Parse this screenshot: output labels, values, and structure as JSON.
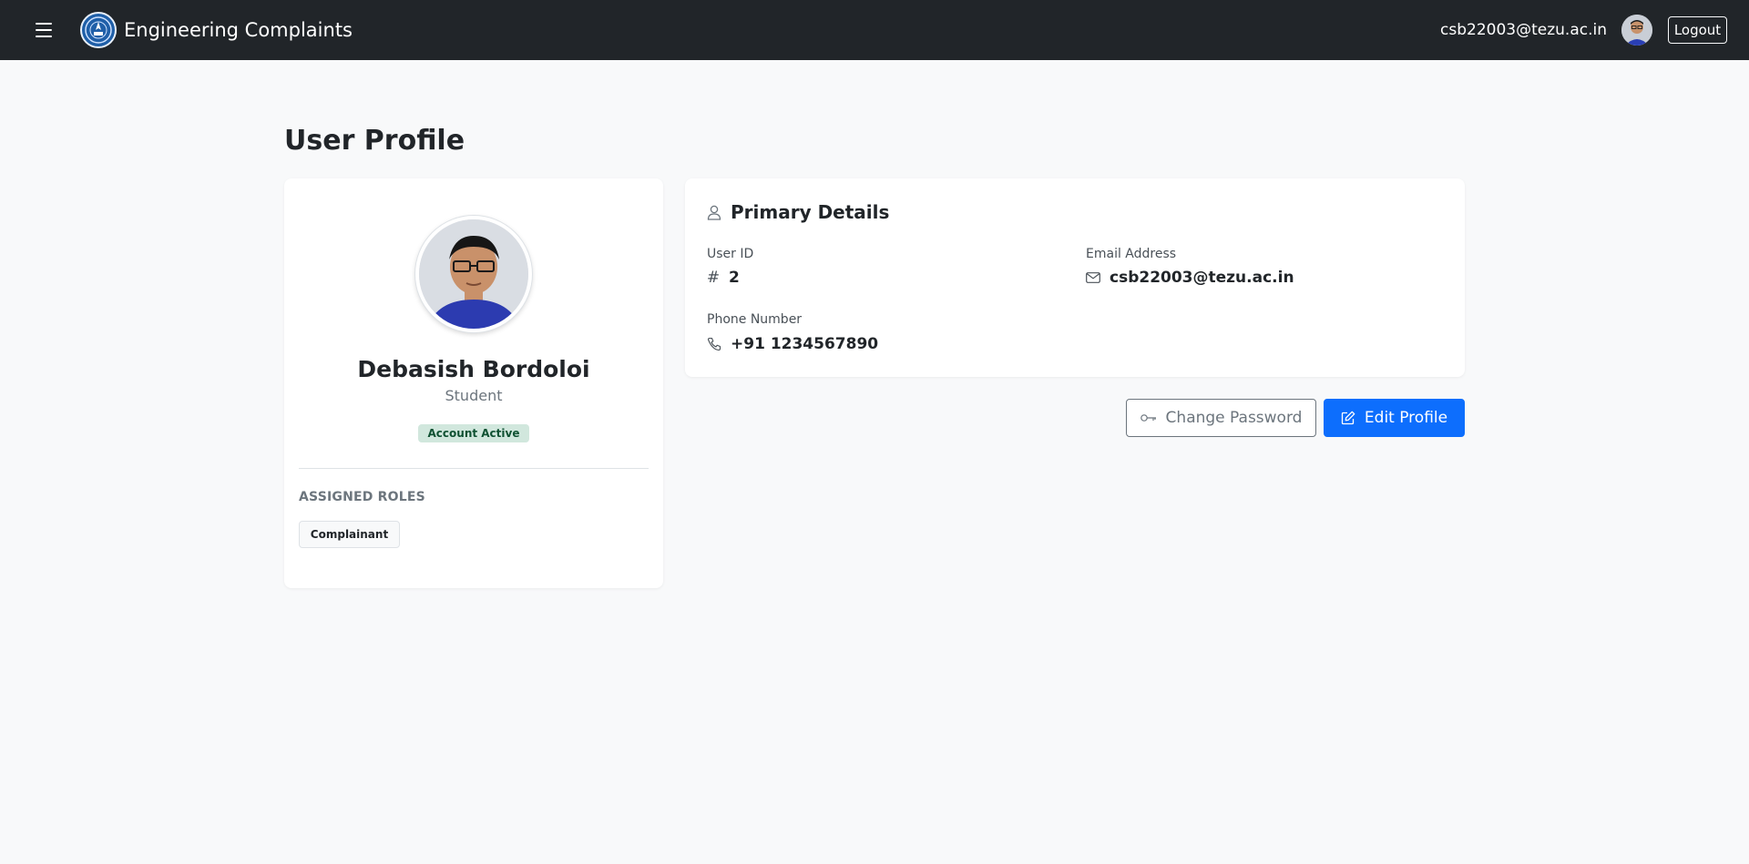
{
  "navbar": {
    "title": "Engineering Complaints",
    "user_email": "csb22003@tezu.ac.in",
    "logout_label": "Logout"
  },
  "page": {
    "title": "User Profile"
  },
  "profile": {
    "name": "Debasish Bordoloi",
    "role": "Student",
    "status": "Account Active",
    "roles_heading": "ASSIGNED ROLES",
    "roles": [
      "Complainant"
    ]
  },
  "details": {
    "heading": "Primary Details",
    "user_id_label": "User ID",
    "user_id": "2",
    "email_label": "Email Address",
    "email": "csb22003@tezu.ac.in",
    "phone_label": "Phone Number",
    "phone": "+91 1234567890"
  },
  "actions": {
    "change_password": "Change Password",
    "edit_profile": "Edit Profile"
  },
  "colors": {
    "navbar_bg": "#212529",
    "primary": "#0d6efd",
    "success_bg": "#d1e7dd",
    "success_text": "#0f5132",
    "page_bg": "#f8f9fa"
  },
  "icons": {
    "menu": "hamburger-icon",
    "user": "person-icon",
    "id": "hash-icon",
    "email": "envelope-icon",
    "phone": "phone-icon",
    "password": "key-icon",
    "edit": "pencil-square-icon"
  }
}
